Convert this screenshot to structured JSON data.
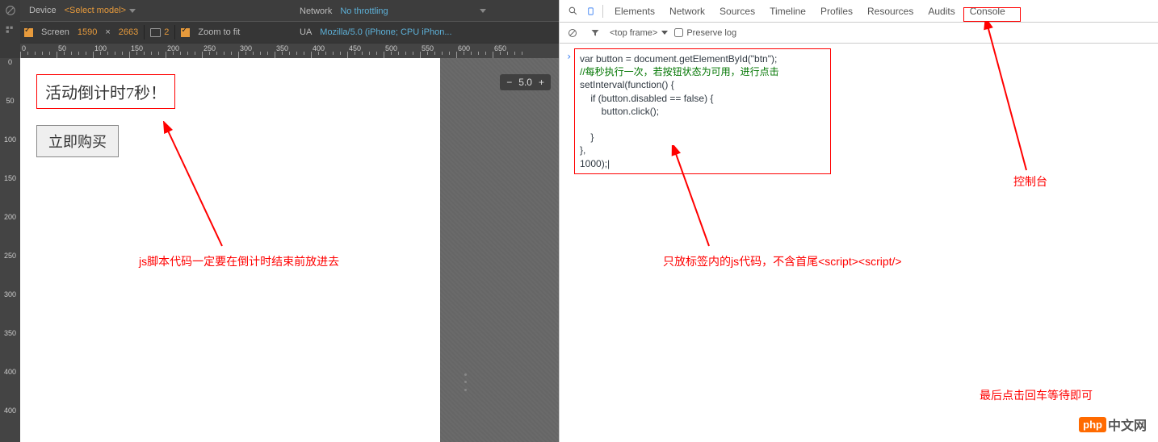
{
  "toolbar": {
    "device_label": "Device",
    "device_select": "<Select model>",
    "screen_label": "Screen",
    "width": "1590",
    "times": "×",
    "height": "2663",
    "dpr": "2",
    "zoom_label": "Zoom to fit",
    "network_label": "Network",
    "network_value": "No throttling",
    "ua_label": "UA",
    "ua_value": "Mozilla/5.0 (iPhone; CPU iPhon..."
  },
  "ruler_h": [
    "0",
    "50",
    "100",
    "150",
    "200",
    "250",
    "300",
    "350",
    "400",
    "450",
    "500",
    "550",
    "600",
    "650"
  ],
  "ruler_v": [
    "0",
    "50",
    "100",
    "150",
    "200",
    "250",
    "300",
    "350",
    "400",
    "400"
  ],
  "viewport": {
    "countdown": "活动倒计时7秒！",
    "buy_btn": "立即购买"
  },
  "zoom_widget": {
    "minus": "−",
    "value": "5.0",
    "plus": "+"
  },
  "devtools": {
    "tabs": [
      "Elements",
      "Network",
      "Sources",
      "Timeline",
      "Profiles",
      "Resources",
      "Audits",
      "Console"
    ],
    "top_frame": "<top frame>",
    "preserve_log": "Preserve log",
    "code_l1": "var button = document.getElementById(\"btn\");",
    "code_l2": "//每秒执行一次，若按钮状态为可用，进行点击",
    "code_l3": "setInterval(function() {",
    "code_l4": "    if (button.disabled == false) {",
    "code_l5": "        button.click();",
    "code_l6": "",
    "code_l7": "    }",
    "code_l8": "},",
    "code_l9": "1000);"
  },
  "annotations": {
    "left": "js脚本代码一定要在倒计时结束前放进去",
    "mid": "只放标签内的js代码，不含首尾<script><script/>",
    "right": "控制台",
    "bottom_right": "最后点击回车等待即可"
  },
  "watermark": {
    "php": "php",
    "cn": "中文网"
  }
}
